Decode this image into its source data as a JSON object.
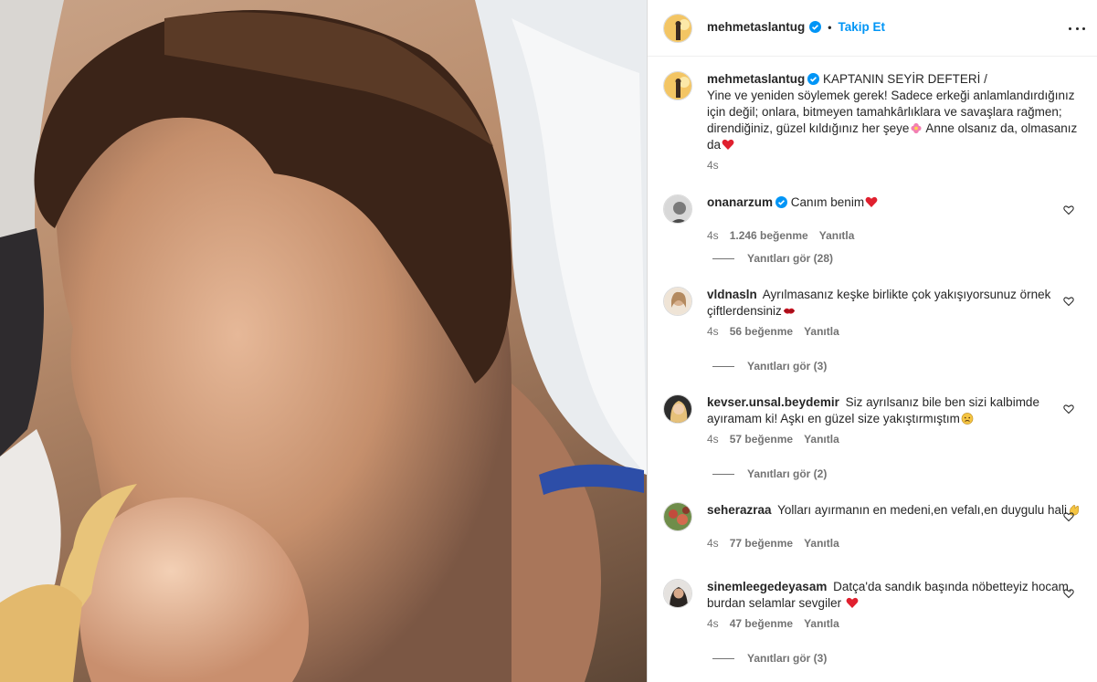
{
  "post": {
    "author": "mehmetaslantug",
    "follow_label": "Takip Et",
    "dot": "•"
  },
  "caption": {
    "user": "mehmetaslantug",
    "text_line1": "KAPTANIN SEYİR DEFTERİ /",
    "text_body": "Yine ve yeniden söylemek gerek! Sadece erkeği anlamlandırdığınız için değil; onlara, bitmeyen tamahkârlıklara ve savaşlara rağmen; direndiğiniz, güzel kıldığınız her şeye",
    "text_end": " Anne olsanız da, olmasanız da",
    "time": "4s"
  },
  "comments": [
    {
      "user": "onanarzum",
      "verified": true,
      "text": "Canım benim",
      "emoji": "heart",
      "time": "4s",
      "likes": "1.246 beğenme",
      "reply": "Yanıtla",
      "replies": "Yanıtları gör (28)"
    },
    {
      "user": "vldnasln",
      "verified": false,
      "text": "Ayrılmasanız keşke birlikte çok yakışıyorsunuz örnek çiftlerdensiniz",
      "emoji": "lips",
      "time": "4s",
      "likes": "56 beğenme",
      "reply": "Yanıtla",
      "replies": "Yanıtları gör (3)"
    },
    {
      "user": "kevser.unsal.beydemir",
      "verified": false,
      "text": "Siz ayrılsanız bile ben sizi kalbimde ayıramam ki! Aşkı en güzel size yakıştırmıştım",
      "emoji": "sad",
      "time": "4s",
      "likes": "57 beğenme",
      "reply": "Yanıtla",
      "replies": "Yanıtları gör (2)"
    },
    {
      "user": "seherazraa",
      "verified": false,
      "text": "Yolları ayırmanın en medeni,en vefalı,en duygulu hali",
      "emoji": "clap",
      "time": "4s",
      "likes": "77 beğenme",
      "reply": "Yanıtla",
      "replies": ""
    },
    {
      "user": "sinemleegedeyasam",
      "verified": false,
      "text": "Datça'da sandık başında nöbetteyiz hocam, burdan selamlar sevgiler",
      "emoji": "heart",
      "time": "4s",
      "likes": "47 beğenme",
      "reply": "Yanıtla",
      "replies": "Yanıtları gör (3)"
    }
  ],
  "colors": {
    "accent": "#0095f6",
    "verified": "#0095f6",
    "text": "#262626",
    "muted": "#737373",
    "heart": "#e0245e"
  },
  "icons": {
    "verified": "verified-badge-icon",
    "more": "more-options-icon",
    "like": "heart-outline-icon"
  }
}
